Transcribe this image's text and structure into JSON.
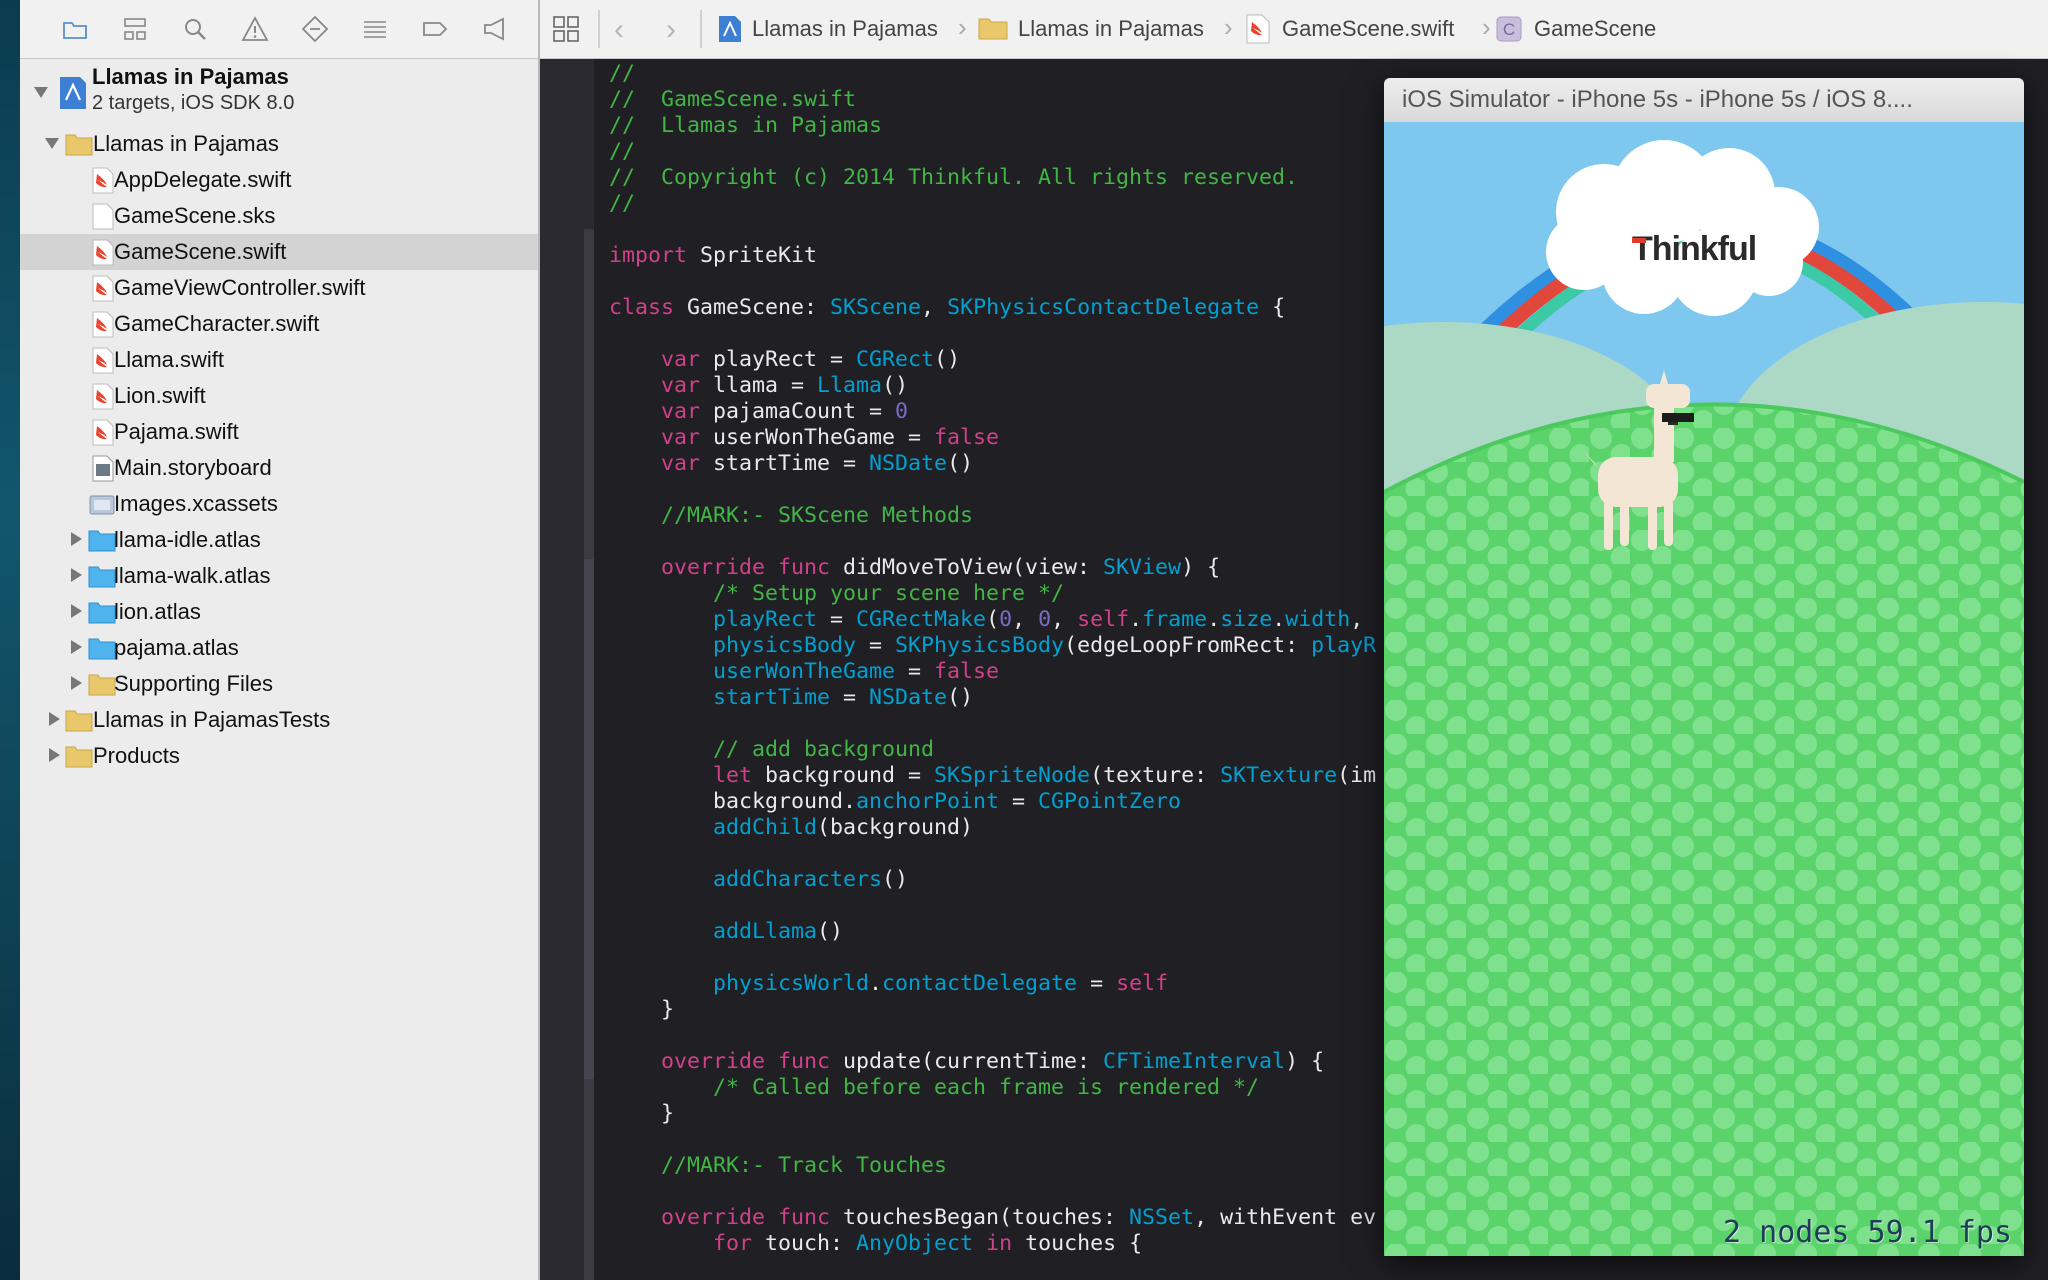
{
  "navigator": {
    "project": {
      "name": "Llamas in Pajamas",
      "subtitle": "2 targets, iOS SDK 8.0"
    },
    "items": [
      {
        "label": "Llamas in Pajamas",
        "kind": "group",
        "expanded": true
      },
      {
        "label": "AppDelegate.swift",
        "kind": "swift"
      },
      {
        "label": "GameScene.sks",
        "kind": "file"
      },
      {
        "label": "GameScene.swift",
        "kind": "swift",
        "selected": true
      },
      {
        "label": "GameViewController.swift",
        "kind": "swift"
      },
      {
        "label": "GameCharacter.swift",
        "kind": "swift"
      },
      {
        "label": "Llama.swift",
        "kind": "swift"
      },
      {
        "label": "Lion.swift",
        "kind": "swift"
      },
      {
        "label": "Pajama.swift",
        "kind": "swift"
      },
      {
        "label": "Main.storyboard",
        "kind": "storyboard"
      },
      {
        "label": "Images.xcassets",
        "kind": "assets"
      },
      {
        "label": "llama-idle.atlas",
        "kind": "atlas"
      },
      {
        "label": "llama-walk.atlas",
        "kind": "atlas"
      },
      {
        "label": "lion.atlas",
        "kind": "atlas"
      },
      {
        "label": "pajama.atlas",
        "kind": "atlas"
      },
      {
        "label": "Supporting Files",
        "kind": "group"
      },
      {
        "label": "Llamas in PajamasTests",
        "kind": "group"
      },
      {
        "label": "Products",
        "kind": "group"
      }
    ]
  },
  "jumpbar": {
    "crumbs": [
      "Llamas in Pajamas",
      "Llamas in Pajamas",
      "GameScene.swift",
      "GameScene"
    ]
  },
  "code_lines": [
    [
      {
        "c": "c",
        "t": "//"
      }
    ],
    [
      {
        "c": "c",
        "t": "//  GameScene.swift"
      }
    ],
    [
      {
        "c": "c",
        "t": "//  Llamas in Pajamas"
      }
    ],
    [
      {
        "c": "c",
        "t": "//"
      }
    ],
    [
      {
        "c": "c",
        "t": "//  Copyright (c) 2014 Thinkful. All rights reserved."
      }
    ],
    [
      {
        "c": "c",
        "t": "//"
      }
    ],
    [],
    [
      {
        "c": "k",
        "t": "import"
      },
      {
        "t": " SpriteKit"
      }
    ],
    [],
    [
      {
        "c": "k",
        "t": "class"
      },
      {
        "t": " GameScene: "
      },
      {
        "c": "t",
        "t": "SKScene"
      },
      {
        "t": ", "
      },
      {
        "c": "t",
        "t": "SKPhysicsContactDelegate"
      },
      {
        "t": " {"
      }
    ],
    [],
    [
      {
        "t": "    "
      },
      {
        "c": "k",
        "t": "var"
      },
      {
        "t": " playRect = "
      },
      {
        "c": "t",
        "t": "CGRect"
      },
      {
        "t": "()"
      }
    ],
    [
      {
        "t": "    "
      },
      {
        "c": "k",
        "t": "var"
      },
      {
        "t": " llama = "
      },
      {
        "c": "t",
        "t": "Llama"
      },
      {
        "t": "()"
      }
    ],
    [
      {
        "t": "    "
      },
      {
        "c": "k",
        "t": "var"
      },
      {
        "t": " pajamaCount = "
      },
      {
        "c": "n",
        "t": "0"
      }
    ],
    [
      {
        "t": "    "
      },
      {
        "c": "k",
        "t": "var"
      },
      {
        "t": " userWonTheGame = "
      },
      {
        "c": "k",
        "t": "false"
      }
    ],
    [
      {
        "t": "    "
      },
      {
        "c": "k",
        "t": "var"
      },
      {
        "t": " startTime = "
      },
      {
        "c": "t",
        "t": "NSDate"
      },
      {
        "t": "()"
      }
    ],
    [],
    [
      {
        "t": "    "
      },
      {
        "c": "c",
        "t": "//MARK:- SKScene Methods"
      }
    ],
    [],
    [
      {
        "t": "    "
      },
      {
        "c": "k",
        "t": "override func"
      },
      {
        "t": " didMoveToView(view: "
      },
      {
        "c": "t",
        "t": "SKView"
      },
      {
        "t": ") {"
      }
    ],
    [
      {
        "t": "        "
      },
      {
        "c": "c",
        "t": "/* Setup your scene here */"
      }
    ],
    [
      {
        "t": "        "
      },
      {
        "c": "t",
        "t": "playRect"
      },
      {
        "t": " = "
      },
      {
        "c": "t",
        "t": "CGRectMake"
      },
      {
        "t": "("
      },
      {
        "c": "n",
        "t": "0"
      },
      {
        "t": ", "
      },
      {
        "c": "n",
        "t": "0"
      },
      {
        "t": ", "
      },
      {
        "c": "k",
        "t": "self"
      },
      {
        "t": "."
      },
      {
        "c": "t",
        "t": "frame"
      },
      {
        "t": "."
      },
      {
        "c": "t",
        "t": "size"
      },
      {
        "t": "."
      },
      {
        "c": "t",
        "t": "width"
      },
      {
        "t": ", "
      }
    ],
    [
      {
        "t": "        "
      },
      {
        "c": "t",
        "t": "physicsBody"
      },
      {
        "t": " = "
      },
      {
        "c": "t",
        "t": "SKPhysicsBody"
      },
      {
        "t": "(edgeLoopFromRect: "
      },
      {
        "c": "t",
        "t": "playR"
      }
    ],
    [
      {
        "t": "        "
      },
      {
        "c": "t",
        "t": "userWonTheGame"
      },
      {
        "t": " = "
      },
      {
        "c": "k",
        "t": "false"
      }
    ],
    [
      {
        "t": "        "
      },
      {
        "c": "t",
        "t": "startTime"
      },
      {
        "t": " = "
      },
      {
        "c": "t",
        "t": "NSDate"
      },
      {
        "t": "()"
      }
    ],
    [],
    [
      {
        "t": "        "
      },
      {
        "c": "c",
        "t": "// add background"
      }
    ],
    [
      {
        "t": "        "
      },
      {
        "c": "k",
        "t": "let"
      },
      {
        "t": " background = "
      },
      {
        "c": "t",
        "t": "SKSpriteNode"
      },
      {
        "t": "(texture: "
      },
      {
        "c": "t",
        "t": "SKTexture"
      },
      {
        "t": "(im"
      }
    ],
    [
      {
        "t": "        background."
      },
      {
        "c": "t",
        "t": "anchorPoint"
      },
      {
        "t": " = "
      },
      {
        "c": "t",
        "t": "CGPointZero"
      }
    ],
    [
      {
        "t": "        "
      },
      {
        "c": "t",
        "t": "addChild"
      },
      {
        "t": "(background)"
      }
    ],
    [],
    [
      {
        "t": "        "
      },
      {
        "c": "t",
        "t": "addCharacters"
      },
      {
        "t": "()"
      }
    ],
    [],
    [
      {
        "t": "        "
      },
      {
        "c": "t",
        "t": "addLlama"
      },
      {
        "t": "()"
      }
    ],
    [],
    [
      {
        "t": "        "
      },
      {
        "c": "t",
        "t": "physicsWorld"
      },
      {
        "t": "."
      },
      {
        "c": "t",
        "t": "contactDelegate"
      },
      {
        "t": " = "
      },
      {
        "c": "k",
        "t": "self"
      }
    ],
    [
      {
        "t": "    }"
      }
    ],
    [],
    [
      {
        "t": "    "
      },
      {
        "c": "k",
        "t": "override func"
      },
      {
        "t": " update(currentTime: "
      },
      {
        "c": "t",
        "t": "CFTimeInterval"
      },
      {
        "t": ") {"
      }
    ],
    [
      {
        "t": "        "
      },
      {
        "c": "c",
        "t": "/* Called before each frame is rendered */"
      }
    ],
    [
      {
        "t": "    }"
      }
    ],
    [],
    [
      {
        "t": "    "
      },
      {
        "c": "c",
        "t": "//MARK:- Track Touches"
      }
    ],
    [],
    [
      {
        "t": "    "
      },
      {
        "c": "k",
        "t": "override func"
      },
      {
        "t": " touchesBegan(touches: "
      },
      {
        "c": "t",
        "t": "NSSet"
      },
      {
        "t": ", withEvent ev"
      }
    ],
    [
      {
        "t": "        "
      },
      {
        "c": "k",
        "t": "for"
      },
      {
        "t": " touch: "
      },
      {
        "c": "t",
        "t": "AnyObject"
      },
      {
        "t": " "
      },
      {
        "c": "k",
        "t": "in"
      },
      {
        "t": " touches {"
      }
    ]
  ],
  "simulator": {
    "title": "iOS Simulator - iPhone 5s - iPhone 5s / iOS 8....",
    "logo_text": "Thinkful",
    "stats": "2 nodes 59.1 fps"
  },
  "colors": {
    "comment": "#41b645",
    "keyword": "#d1408a",
    "type": "#00a0d1",
    "number": "#786dc4",
    "editor_bg": "#1f1f24",
    "grass": "#5ad46a"
  }
}
